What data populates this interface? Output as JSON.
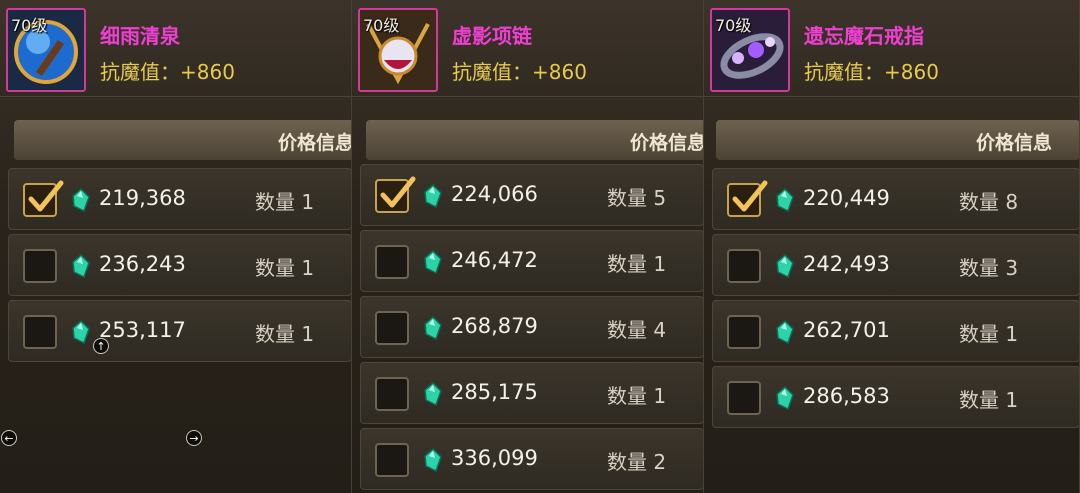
{
  "columns": [
    {
      "level": "70级",
      "name": "细雨清泉",
      "stat": "抗魔值：+860",
      "header": "价格信息",
      "rows": [
        {
          "checked": true,
          "price": "219,368",
          "qty": "数量 1"
        },
        {
          "checked": false,
          "price": "236,243",
          "qty": "数量 1"
        },
        {
          "checked": false,
          "price": "253,117",
          "qty": "数量 1"
        }
      ]
    },
    {
      "level": "70级",
      "name": "虚影项链",
      "stat": "抗魔值：+860",
      "header": "价格信息",
      "rows": [
        {
          "checked": true,
          "price": "224,066",
          "qty": "数量 5"
        },
        {
          "checked": false,
          "price": "246,472",
          "qty": "数量 1"
        },
        {
          "checked": false,
          "price": "268,879",
          "qty": "数量 4"
        },
        {
          "checked": false,
          "price": "285,175",
          "qty": "数量 1"
        },
        {
          "checked": false,
          "price": "336,099",
          "qty": "数量 2"
        }
      ]
    },
    {
      "level": "70级",
      "name": "遗忘魔石戒指",
      "stat": "抗魔值：+860",
      "header": "价格信息",
      "rows": [
        {
          "checked": true,
          "price": "220,449",
          "qty": "数量 8"
        },
        {
          "checked": false,
          "price": "242,493",
          "qty": "数量 3"
        },
        {
          "checked": false,
          "price": "262,701",
          "qty": "数量 1"
        },
        {
          "checked": false,
          "price": "286,583",
          "qty": "数量 1"
        }
      ]
    }
  ],
  "colors": {
    "name": "#ee3fd0",
    "stat": "#e8cb4a",
    "frame": "#d13a96"
  },
  "icons": [
    "blue-orb-icon",
    "pendant-necklace-icon",
    "magic-ring-icon",
    "green-gem-icon",
    "checkmark-icon"
  ]
}
